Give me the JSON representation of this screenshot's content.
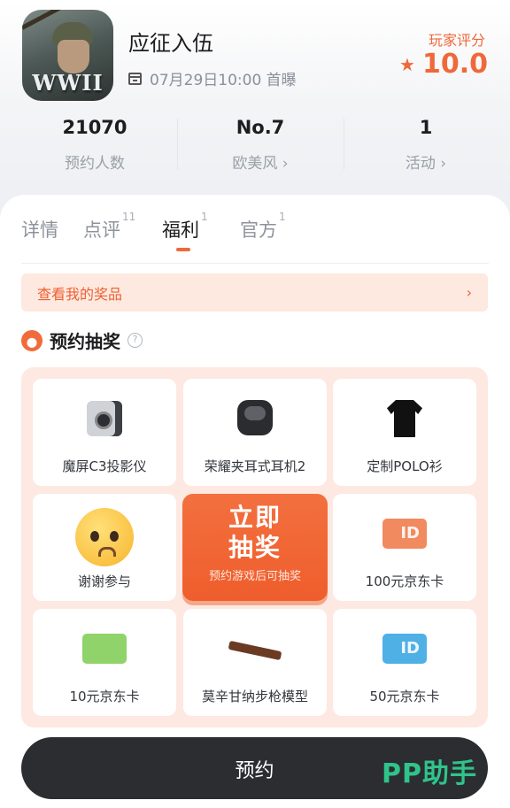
{
  "game": {
    "title": "应征入伍",
    "icon_text": "WWII",
    "release": "07月29日10:00 首曝",
    "score_label": "玩家评分",
    "score": "10.0"
  },
  "stats": [
    {
      "value": "21070",
      "label": "预约人数"
    },
    {
      "value": "No.7",
      "label": "欧美风 ›"
    },
    {
      "value": "1",
      "label": "活动 ›"
    }
  ],
  "tabs": [
    {
      "label": "详情",
      "count": ""
    },
    {
      "label": "点评",
      "count": "11"
    },
    {
      "label": "福利",
      "count": "1"
    },
    {
      "label": "官方",
      "count": "1"
    }
  ],
  "active_tab": "福利",
  "prize_bar": {
    "label": "查看我的奖品",
    "chevron": "›"
  },
  "section": {
    "title": "预约抽奖",
    "help": "?"
  },
  "prizes": [
    {
      "label": "魔屏C3投影仪",
      "icon": "projector-icon"
    },
    {
      "label": "荣耀夹耳式耳机2",
      "icon": "earbuds-icon"
    },
    {
      "label": "定制POLO衫",
      "icon": "polo-shirt-icon"
    },
    {
      "label": "谢谢参与",
      "icon": "sad-emoji-icon"
    },
    {
      "label": "100元京东卡",
      "icon": "gift-card-icon"
    },
    {
      "label": "10元京东卡",
      "icon": "gift-card-icon"
    },
    {
      "label": "莫辛甘纳步枪模型",
      "icon": "rifle-icon"
    },
    {
      "label": "50元京东卡",
      "icon": "gift-card-icon"
    }
  ],
  "draw_button": {
    "line1": "立即",
    "line2": "抽奖",
    "note": "预约游戏后可抽奖"
  },
  "bottom": {
    "reserve_label": "预约",
    "logo": "PP助手"
  },
  "colors": {
    "accent": "#f0683a",
    "card_orange": "#f28a5f",
    "card_green": "#8fd36a",
    "card_blue": "#4fb0e6"
  }
}
